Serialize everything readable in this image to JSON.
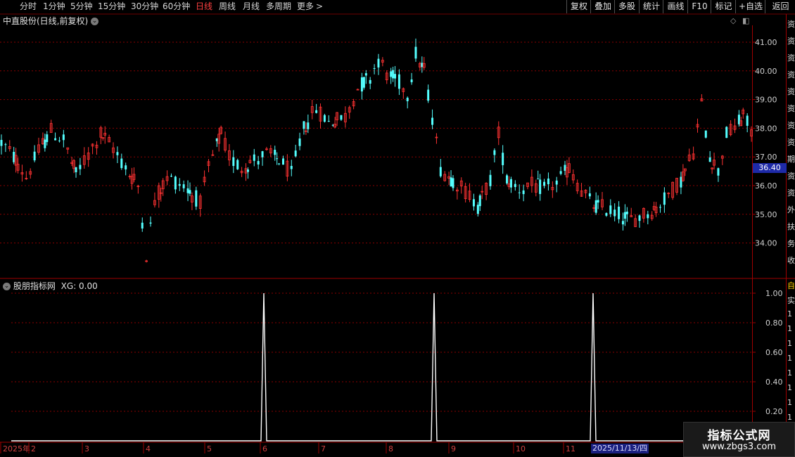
{
  "toolbar": {
    "periods": [
      {
        "label": "分时",
        "active": false
      },
      {
        "label": "1分钟",
        "active": false
      },
      {
        "label": "5分钟",
        "active": false
      },
      {
        "label": "15分钟",
        "active": false
      },
      {
        "label": "30分钟",
        "active": false
      },
      {
        "label": "60分钟",
        "active": false
      },
      {
        "label": "日线",
        "active": true
      },
      {
        "label": "周线",
        "active": false
      },
      {
        "label": "月线",
        "active": false
      },
      {
        "label": "多周期",
        "active": false
      },
      {
        "label": "更多",
        "active": false
      }
    ],
    "more_arrow": ">",
    "right_buttons": [
      "复权",
      "叠加",
      "多股",
      "统计",
      "画线",
      "F10",
      "标记",
      "+自选",
      "返回"
    ]
  },
  "main_panel": {
    "title": "中直股份(日线,前复权)",
    "current_price_badge": "36.40",
    "price_ticks": [
      "41.00",
      "40.00",
      "39.00",
      "38.00",
      "37.00",
      "36.00",
      "35.00",
      "34.00"
    ]
  },
  "indicator_panel": {
    "title": "股朋指标网",
    "value_label": "XG: 0.00",
    "ticks": [
      "1.00",
      "0.80",
      "0.60",
      "0.40",
      "0.20"
    ]
  },
  "x_axis": {
    "labels": [
      "2025年",
      "2",
      "3",
      "4",
      "5",
      "6",
      "7",
      "8",
      "9",
      "10",
      "11"
    ],
    "cursor_date": "2025/11/13/四"
  },
  "right_strip_chars": [
    "资",
    "资",
    "资",
    "资",
    "资",
    "资",
    "资",
    "资",
    "期",
    "资",
    "资",
    "外",
    "扶",
    "务",
    "收"
  ],
  "right_strip_chars_bottom": [
    "自",
    "实",
    "1",
    "1",
    "1",
    "1",
    "1",
    "1",
    "1",
    "1"
  ],
  "watermark": {
    "title": "指标公式网",
    "url": "www.zbgs3.com"
  },
  "colors": {
    "up": "#ff3232",
    "down": "#54ffff",
    "grid": "#8b0000",
    "axis": "#a00000",
    "signal": "#ffffff"
  },
  "chart_data": {
    "type": "candlestick",
    "price_axis": {
      "min": 33.0,
      "max": 41.8
    },
    "indicator_axis": {
      "min": 0,
      "max": 1.1
    },
    "ohlc_summary": [
      {
        "phase": "Jan-Feb",
        "range": [
          35.7,
          38.7
        ]
      },
      {
        "phase": "Mar-Apr",
        "low": 33.3,
        "range": [
          33.3,
          37.0
        ]
      },
      {
        "phase": "May-Jul",
        "range": [
          35.1,
          39.0
        ]
      },
      {
        "phase": "Aug",
        "high": 41.5,
        "range": [
          38.8,
          41.5
        ]
      },
      {
        "phase": "Sep",
        "range": [
          35.0,
          40.8
        ]
      },
      {
        "phase": "Oct-Nov",
        "range": [
          34.5,
          38.3
        ]
      },
      {
        "phase": "Dec",
        "range": [
          36.2,
          39.1
        ]
      }
    ],
    "xg_signal": {
      "name": "XG",
      "current_value": 0.0,
      "spikes_at_months": [
        "6",
        "8",
        "11"
      ],
      "spike_value": 1.0
    }
  }
}
